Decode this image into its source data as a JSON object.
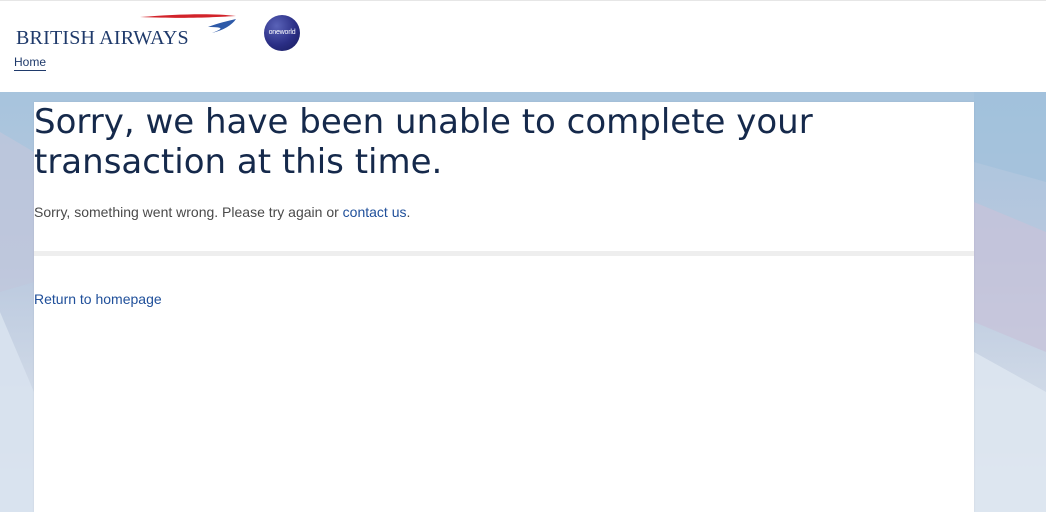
{
  "header": {
    "brand": "BRITISH AIRWAYS",
    "partner_logo": "oneworld",
    "home_link": "Home"
  },
  "error": {
    "title": "Sorry, we have been unable to complete your transaction at this time.",
    "message_prefix": "Sorry, something went wrong. Please try again or ",
    "contact_link": "contact us",
    "message_suffix": ".",
    "return_link": "Return to homepage"
  },
  "colors": {
    "brand_navy": "#1f3a6b",
    "link_blue": "#1f4f9a",
    "speedmarque_red": "#d2232a",
    "speedmarque_blue": "#2e5aa8"
  }
}
